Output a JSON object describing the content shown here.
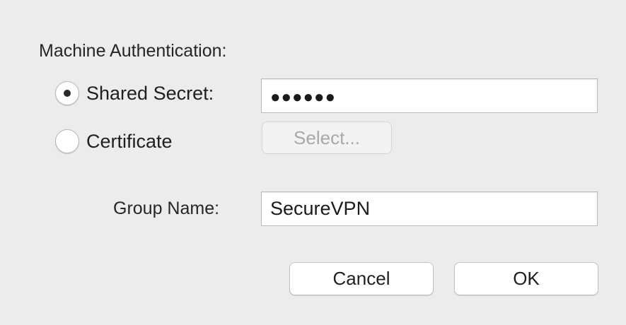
{
  "machine_auth": {
    "section_label": "Machine Authentication:",
    "shared_secret": {
      "label": "Shared Secret:",
      "selected": true,
      "masked_value": "●●●●●●"
    },
    "certificate": {
      "label": "Certificate",
      "selected": false,
      "select_button_label": "Select...",
      "select_button_enabled": false
    }
  },
  "group": {
    "label": "Group Name:",
    "value": "SecureVPN"
  },
  "buttons": {
    "cancel_label": "Cancel",
    "ok_label": "OK"
  },
  "colors": {
    "background": "#ececec",
    "field_background": "#ffffff",
    "disabled_text": "#a9a9a9"
  },
  "icons": {
    "radio_selected": "radio-selected-icon",
    "radio_unselected": "radio-unselected-icon"
  }
}
